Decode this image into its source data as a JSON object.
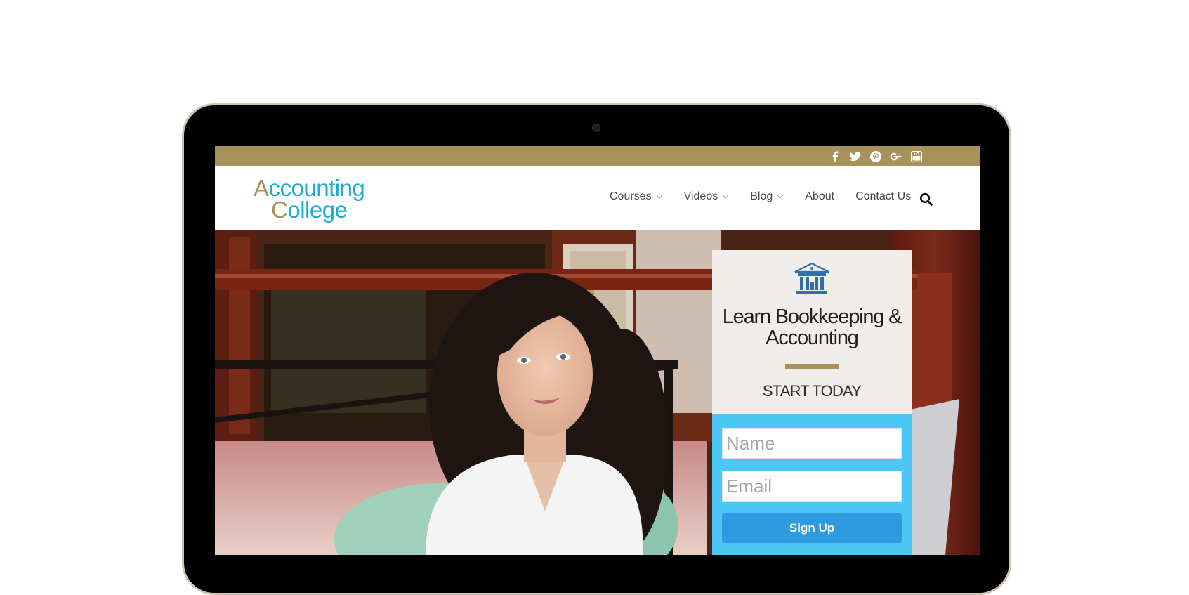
{
  "topbar": {
    "social_icons": [
      "facebook-icon",
      "twitter-icon",
      "pinterest-icon",
      "google-plus-icon",
      "youtube-icon"
    ],
    "color": "#a8925c"
  },
  "logo": {
    "line1_first": "A",
    "line1_rest": "ccounting",
    "line2_first": "C",
    "line2_rest": "ollege"
  },
  "nav": {
    "items": [
      {
        "label": "Courses",
        "has_dropdown": true
      },
      {
        "label": "Videos",
        "has_dropdown": true
      },
      {
        "label": "Blog",
        "has_dropdown": true
      },
      {
        "label": "About",
        "has_dropdown": false
      },
      {
        "label": "Contact Us",
        "has_dropdown": false
      }
    ]
  },
  "panel": {
    "heading_line1": "Learn Bookkeeping &",
    "heading_line2": "Accounting",
    "subheading": "START TODAY",
    "name_placeholder": "Name",
    "email_placeholder": "Email",
    "submit_label": "Sign Up"
  },
  "colors": {
    "gold": "#a8925c",
    "teal": "#1aaed0",
    "form_bg": "#4cc6f5",
    "button": "#2e9be0"
  }
}
